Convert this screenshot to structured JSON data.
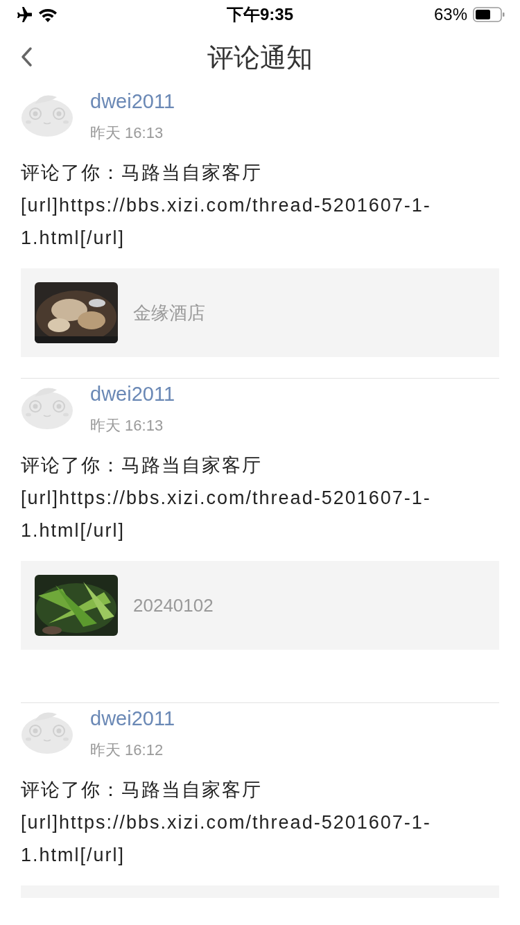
{
  "status_bar": {
    "time": "下午9:35",
    "battery": "63%"
  },
  "nav": {
    "title": "评论通知"
  },
  "notifications": [
    {
      "user": "dwei2011",
      "time": "昨天 16:13",
      "text": "评论了你：马路当自家客厅\n[url]https://bbs.xizi.com/thread-5201607-1-1.html[/url]",
      "attachment": {
        "title": "金缘酒店",
        "kind": "food"
      }
    },
    {
      "user": "dwei2011",
      "time": "昨天 16:13",
      "text": "评论了你：马路当自家客厅\n[url]https://bbs.xizi.com/thread-5201607-1-1.html[/url]",
      "attachment": {
        "title": "20240102",
        "kind": "greens"
      }
    },
    {
      "user": "dwei2011",
      "time": "昨天 16:12",
      "text": "评论了你：马路当自家客厅\n[url]https://bbs.xizi.com/thread-5201607-1-1.html[/url]",
      "attachment": {
        "kind": "partial"
      }
    }
  ]
}
